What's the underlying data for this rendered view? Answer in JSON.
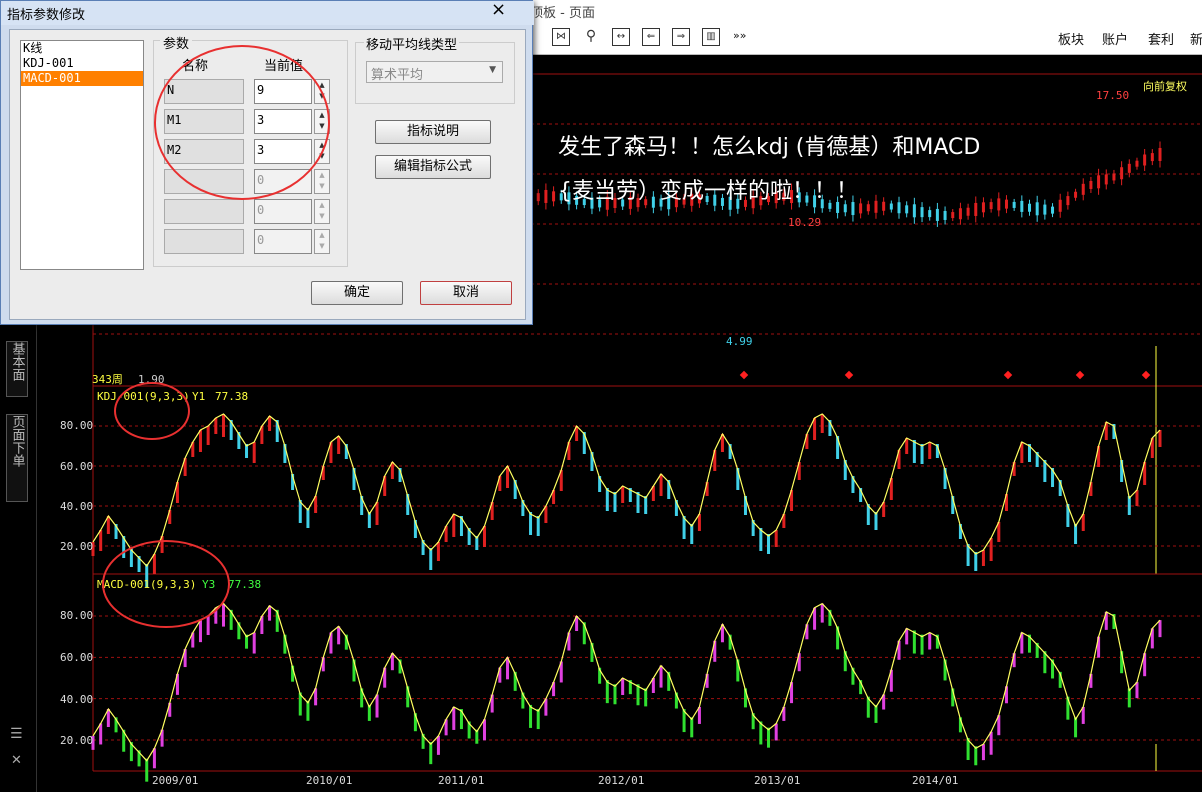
{
  "window": {
    "title": "顶板 - 页面"
  },
  "toolbar": {
    "icons": [
      "zoom-icon",
      "fullscreen-icon",
      "search-icon",
      "width-icon",
      "back-icon",
      "forward-icon",
      "layout-icon"
    ],
    "more": "»»",
    "items": [
      "板块",
      "账户",
      "套利",
      "新"
    ]
  },
  "sidebar": {
    "tabs": [
      "基本面",
      "页面下单"
    ],
    "icons": [
      "list-icon",
      "close-icon"
    ]
  },
  "dialog": {
    "title": "指标参数修改",
    "close": "×",
    "indicator_list": [
      "K线",
      "KDJ-001",
      "MACD-001"
    ],
    "selected_index": 2,
    "param_group_label": "参数",
    "col_name": "名称",
    "col_value": "当前值",
    "params": [
      {
        "name": "N",
        "value": "9",
        "enabled": true
      },
      {
        "name": "M1",
        "value": "3",
        "enabled": true
      },
      {
        "name": "M2",
        "value": "3",
        "enabled": true
      },
      {
        "name": "",
        "value": "0",
        "enabled": false
      },
      {
        "name": "",
        "value": "0",
        "enabled": false
      },
      {
        "name": "",
        "value": "0",
        "enabled": false
      }
    ],
    "ma_group_label": "移动平均线类型",
    "ma_select_value": "算术平均",
    "btn_explain": "指标说明",
    "btn_edit": "编辑指标公式",
    "btn_ok": "确定",
    "btn_cancel": "取消"
  },
  "annotation": {
    "line1": "发生了森马！！怎么kdj (肯德基）和MACD",
    "line2": "{麦当劳）变成一样的啦！！！"
  },
  "price_panel": {
    "period_label": "343周",
    "low_label": "1.90",
    "high_label": "17.50",
    "mid_high": "10.29",
    "mid_low": "4.99",
    "fq_label": "向前复权"
  },
  "kdj_panel": {
    "label": "KDJ-001(9,3,3)",
    "series": "Y1",
    "value": "77.38",
    "yticks": [
      "80.00",
      "60.00",
      "40.00",
      "20.00"
    ]
  },
  "macd_panel": {
    "label": "MACD-001(9,3,3)",
    "series": "Y3",
    "value": "77.38",
    "yticks": [
      "80.00",
      "60.00",
      "40.00",
      "20.00"
    ]
  },
  "x_axis": {
    "ticks": [
      "2009/01",
      "2010/01",
      "2011/01",
      "2012/01",
      "2013/01",
      "2014/01"
    ]
  },
  "colors": {
    "up": "#e02020",
    "down": "#40d0e8",
    "macd_up": "#e040e0",
    "macd_down": "#30e030",
    "line": "#ffff60",
    "grid": "#a01010",
    "annotation_circle": "#e83030"
  },
  "chart_data": {
    "type": "bar",
    "title": "",
    "osc_values": [
      22,
      28,
      35,
      30,
      24,
      18,
      14,
      10,
      16,
      25,
      38,
      52,
      64,
      72,
      78,
      80,
      84,
      86,
      82,
      76,
      70,
      72,
      80,
      85,
      82,
      70,
      55,
      42,
      38,
      45,
      60,
      72,
      75,
      70,
      58,
      44,
      36,
      42,
      55,
      62,
      58,
      45,
      32,
      22,
      18,
      22,
      30,
      36,
      34,
      28,
      24,
      30,
      42,
      55,
      60,
      52,
      42,
      36,
      34,
      40,
      48,
      58,
      72,
      80,
      76,
      66,
      54,
      48,
      46,
      50,
      48,
      46,
      44,
      50,
      56,
      52,
      42,
      34,
      30,
      36,
      52,
      68,
      76,
      70,
      58,
      44,
      32,
      28,
      25,
      28,
      36,
      48,
      62,
      76,
      84,
      86,
      82,
      74,
      62,
      54,
      48,
      40,
      36,
      42,
      54,
      68,
      74,
      72,
      70,
      72,
      70,
      58,
      44,
      30,
      20,
      16,
      18,
      24,
      32,
      46,
      62,
      72,
      70,
      66,
      62,
      58,
      52,
      40,
      30,
      36,
      52,
      70,
      82,
      80,
      62,
      44,
      48,
      62,
      74,
      78
    ]
  }
}
